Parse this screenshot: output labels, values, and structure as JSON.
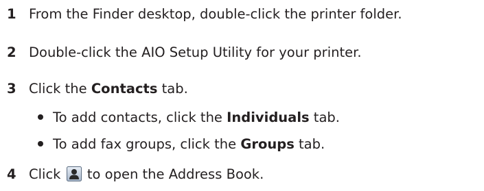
{
  "steps": [
    {
      "number": "1",
      "text": "From the Finder desktop, double-click the printer folder."
    },
    {
      "number": "2",
      "text": "Double-click the AIO Setup Utility for your printer."
    },
    {
      "number": "3",
      "text_before": "Click the ",
      "bold": "Contacts",
      "text_after": " tab.",
      "bullets": [
        {
          "text_before": "To add contacts, click the ",
          "bold": "Individuals",
          "text_after": " tab."
        },
        {
          "text_before": "To add fax groups, click the ",
          "bold": "Groups",
          "text_after": " tab."
        }
      ]
    },
    {
      "number": "4",
      "text_before": "Click ",
      "icon": "contact-person-icon",
      "text_after": " to open the Address Book."
    }
  ]
}
